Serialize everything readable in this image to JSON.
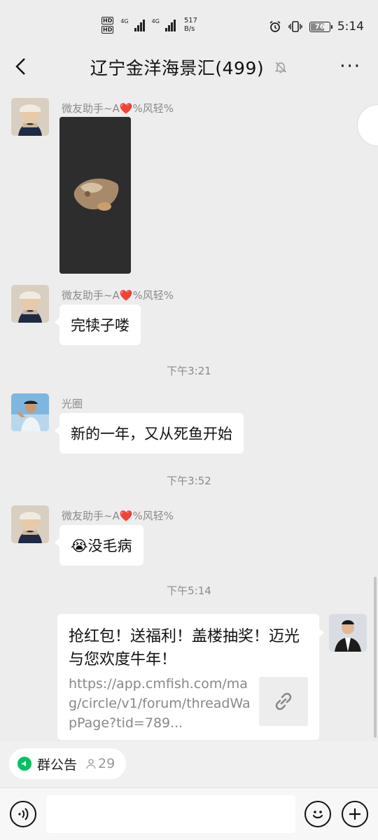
{
  "status_bar": {
    "hd1": "HD",
    "hd2": "HD",
    "net1": "4G",
    "net2": "4G",
    "speed_value": "517",
    "speed_unit": "B/s",
    "battery": "76",
    "time": "5:14"
  },
  "header": {
    "title": "辽宁金洋海景汇(499)",
    "back_icon": "back-chevron-icon",
    "mute_icon": "bell-muted-icon",
    "more_label": "···"
  },
  "messages": [
    {
      "type": "image",
      "sender": "微友助手~A❤️%风轻%"
    },
    {
      "type": "text",
      "sender": "微友助手~A❤️%风轻%",
      "text": "完犊子喽"
    },
    {
      "type": "time",
      "text": "下午3:21"
    },
    {
      "type": "text",
      "sender": "光圈",
      "text": "新的一年，又从死鱼开始"
    },
    {
      "type": "time",
      "text": "下午3:52"
    },
    {
      "type": "text",
      "sender": "微友助手~A❤️%风轻%",
      "text": "😭没毛病"
    },
    {
      "type": "time",
      "text": "下午5:14"
    },
    {
      "type": "link",
      "title": "抢红包！送福利！盖楼抽奖！迈光与您欢度牛年！",
      "url": "https://app.cmfish.com/mag/circle/v1/forum/threadWapPage?tid=789..."
    }
  ],
  "announcement": {
    "label": "群公告",
    "count": "29"
  },
  "input_bar": {
    "voice_icon": "voice-icon",
    "emoji_icon": "emoji-icon",
    "plus_icon": "plus-icon",
    "placeholder": ""
  },
  "colors": {
    "background": "#ededed",
    "bubble": "#ffffff",
    "accent_green": "#07c160",
    "meta_gray": "#8a8a8a"
  }
}
